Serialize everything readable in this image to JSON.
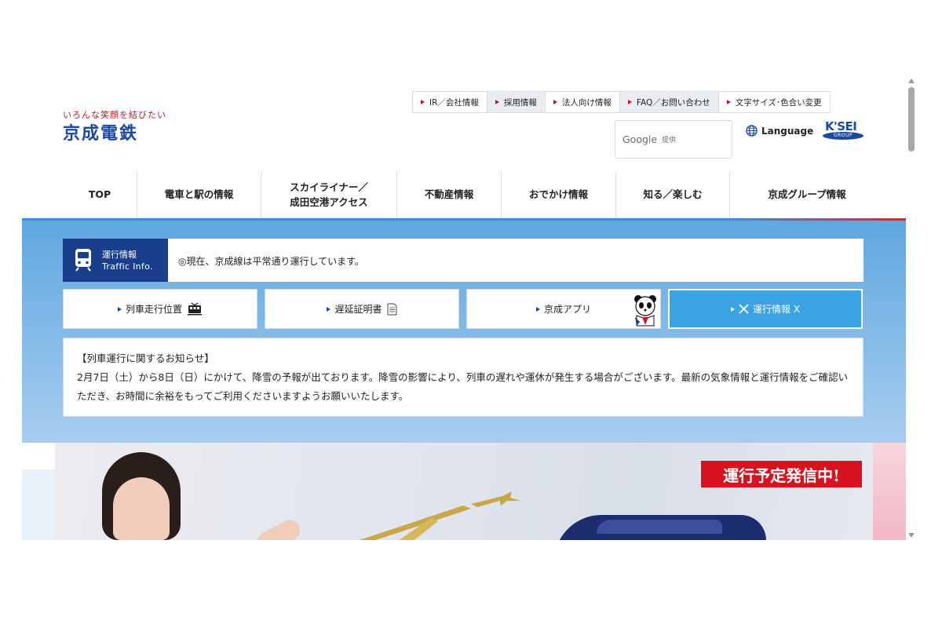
{
  "logo": {
    "tagline": "いろんな笑顔を結びたい",
    "name": "京成電鉄"
  },
  "util_links": [
    {
      "label": "IR／会社情報"
    },
    {
      "label": "採用情報"
    },
    {
      "label": "法人向け情報"
    },
    {
      "label": "FAQ／お問い合わせ"
    },
    {
      "label": "文字サイズ･色合い変更"
    }
  ],
  "search": {
    "google": "Google",
    "provided": "提供"
  },
  "language": {
    "label": "Language"
  },
  "group_logo": {
    "text": "K'SEI",
    "sub": "GROUP"
  },
  "nav": [
    {
      "label": "TOP"
    },
    {
      "label": "電車と駅の情報"
    },
    {
      "label": "スカイライナー／\n成田空港アクセス"
    },
    {
      "label": "不動産情報"
    },
    {
      "label": "おでかけ情報"
    },
    {
      "label": "知る／楽しむ"
    },
    {
      "label": "京成グループ情報"
    }
  ],
  "traffic": {
    "label_jp": "運行情報",
    "label_en": "Traffic Info.",
    "message": "◎現在、京成線は平常通り運行しています。"
  },
  "shortcuts": [
    {
      "label": "列車走行位置",
      "icon": "train-icon"
    },
    {
      "label": "遅延証明書",
      "icon": "document-icon"
    },
    {
      "label": "京成アプリ",
      "icon": "panda-icon"
    },
    {
      "label": "運行情報 X",
      "icon": "x-logo-icon"
    }
  ],
  "notice": {
    "title": "【列車運行に関するお知らせ】",
    "body": "2月7日（土）から8日（日）にかけて、降雪の予報が出ております。降雪の影響により、列車の遅れや運休が発生する場合がございます。最新の気象情報と運行情報をご確認いただき、お時間に余裕をもってご利用くださいますようお願いいたします。"
  },
  "hero": {
    "banner": "運行予定発信中!"
  },
  "colors": {
    "brand_blue": "#1b4aa0",
    "brand_red": "#c0182a",
    "band_top": "#5fa7e0",
    "band_bottom": "#a7cdef",
    "x_button": "#3aa3e4",
    "banner_red": "#d8121f"
  }
}
